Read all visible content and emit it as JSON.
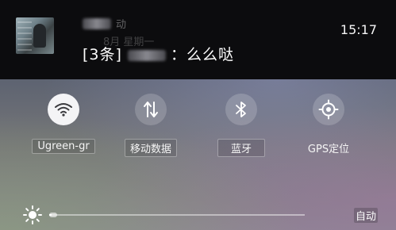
{
  "notification": {
    "title_suffix": "动",
    "message": "[3条]",
    "message_tail": "：么么哒",
    "time": "15:17",
    "faded_text": "8月     星期一"
  },
  "toggles": [
    {
      "label": "Ugreen-gr",
      "icon": "wifi-icon",
      "state": "on"
    },
    {
      "label": "移动数据",
      "icon": "mobile-data-icon",
      "state": "off"
    },
    {
      "label": "蓝牙",
      "icon": "bluetooth-icon",
      "state": "off"
    },
    {
      "label": "GPS定位",
      "icon": "gps-icon",
      "state": "off"
    }
  ],
  "brightness": {
    "level": 0.01,
    "auto_label": "自动"
  },
  "colors": {
    "notification_bg": "#0c0c0e",
    "active_toggle": "#f4f4f6",
    "active_icon": "#3a3a3e",
    "inactive_icon": "#ffffff"
  }
}
